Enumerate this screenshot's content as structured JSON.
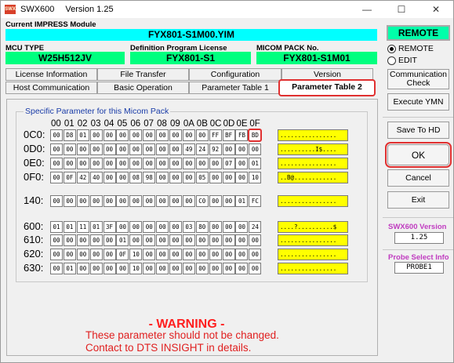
{
  "window": {
    "title": "SWX600",
    "version_label": "Version  1.25",
    "app_icon_text": "SWX",
    "controls": {
      "minimize": "—",
      "maximize": "☐",
      "close": "✕"
    }
  },
  "module": {
    "label": "Current IMPRESS Module",
    "value": "FYX801-S1M00.YIM"
  },
  "info": {
    "mcu_type": {
      "label": "MCU TYPE",
      "value": "W25H512JV"
    },
    "license": {
      "label": "Definition Program License",
      "value": "FYX801-S1"
    },
    "micom_pack": {
      "label": "MICOM PACK No.",
      "value": "FYX801-S1M01"
    }
  },
  "tabs_row1": [
    "License Information",
    "File Transfer",
    "Configuration",
    "Version"
  ],
  "tabs_row2": [
    "Host Communication",
    "Basic Operation",
    "Parameter Table 1",
    "Parameter Table 2"
  ],
  "group_title": "Specific Parameter for this Micom Pack",
  "hex_header": [
    "00",
    "01",
    "02",
    "03",
    "04",
    "05",
    "06",
    "07",
    "08",
    "09",
    "0A",
    "0B",
    "0C",
    "0D",
    "0E",
    "0F"
  ],
  "rows": [
    {
      "addr": "0C0:",
      "cells": [
        "00",
        "D8",
        "01",
        "00",
        "00",
        "00",
        "00",
        "00",
        "00",
        "00",
        "00",
        "00",
        "FF",
        "BF",
        "FB",
        "BD"
      ],
      "ascii": "................"
    },
    {
      "addr": "0D0:",
      "cells": [
        "00",
        "00",
        "00",
        "00",
        "00",
        "00",
        "00",
        "00",
        "00",
        "00",
        "49",
        "24",
        "92",
        "00",
        "00",
        "00"
      ],
      "ascii": "..........I$...."
    },
    {
      "addr": "0E0:",
      "cells": [
        "00",
        "00",
        "00",
        "00",
        "00",
        "00",
        "00",
        "00",
        "00",
        "00",
        "00",
        "00",
        "00",
        "07",
        "00",
        "01"
      ],
      "ascii": "................"
    },
    {
      "addr": "0F0:",
      "cells": [
        "00",
        "0F",
        "42",
        "40",
        "00",
        "00",
        "08",
        "98",
        "00",
        "00",
        "00",
        "05",
        "00",
        "00",
        "00",
        "10"
      ],
      "ascii": "..B@............"
    },
    {
      "addr": "140:",
      "cells": [
        "00",
        "00",
        "00",
        "00",
        "00",
        "00",
        "00",
        "00",
        "00",
        "00",
        "00",
        "C0",
        "00",
        "00",
        "01",
        "FC"
      ],
      "ascii": "................"
    },
    {
      "addr": "600:",
      "cells": [
        "01",
        "01",
        "11",
        "01",
        "3F",
        "00",
        "00",
        "00",
        "00",
        "00",
        "03",
        "80",
        "00",
        "00",
        "00",
        "24"
      ],
      "ascii": "....?..........$"
    },
    {
      "addr": "610:",
      "cells": [
        "00",
        "00",
        "00",
        "00",
        "00",
        "01",
        "00",
        "00",
        "00",
        "00",
        "00",
        "00",
        "00",
        "00",
        "00",
        "00"
      ],
      "ascii": "................"
    },
    {
      "addr": "620:",
      "cells": [
        "00",
        "00",
        "00",
        "00",
        "00",
        "0F",
        "10",
        "00",
        "00",
        "00",
        "00",
        "00",
        "00",
        "00",
        "00",
        "00"
      ],
      "ascii": "................"
    },
    {
      "addr": "630:",
      "cells": [
        "00",
        "01",
        "00",
        "00",
        "00",
        "00",
        "10",
        "00",
        "00",
        "00",
        "00",
        "00",
        "00",
        "00",
        "00",
        "00"
      ],
      "ascii": "................"
    }
  ],
  "warning": {
    "title": "- WARNING -",
    "line1": "These parameter should not be changed.",
    "line2": "Contact to DTS INSIGHT in details."
  },
  "side": {
    "remote_button": "REMOTE",
    "radio_remote": "REMOTE",
    "radio_edit": "EDIT",
    "selected_mode": "REMOTE",
    "communication_check": "Communication Check",
    "execute_ymn": "Execute YMN",
    "save_to_hd": "Save To HD",
    "ok": "OK",
    "cancel": "Cancel",
    "exit": "Exit",
    "swx_version_label": "SWX600 Version",
    "swx_version_value": "1.25",
    "probe_label": "Probe Select Info",
    "probe_value": "PROBE1"
  },
  "colors": {
    "cyan": "#00ffff",
    "green": "#00ff7f",
    "ascii_yellow": "#ffff00",
    "highlight_red": "#e03030",
    "info_magenta": "#c03cc0"
  }
}
